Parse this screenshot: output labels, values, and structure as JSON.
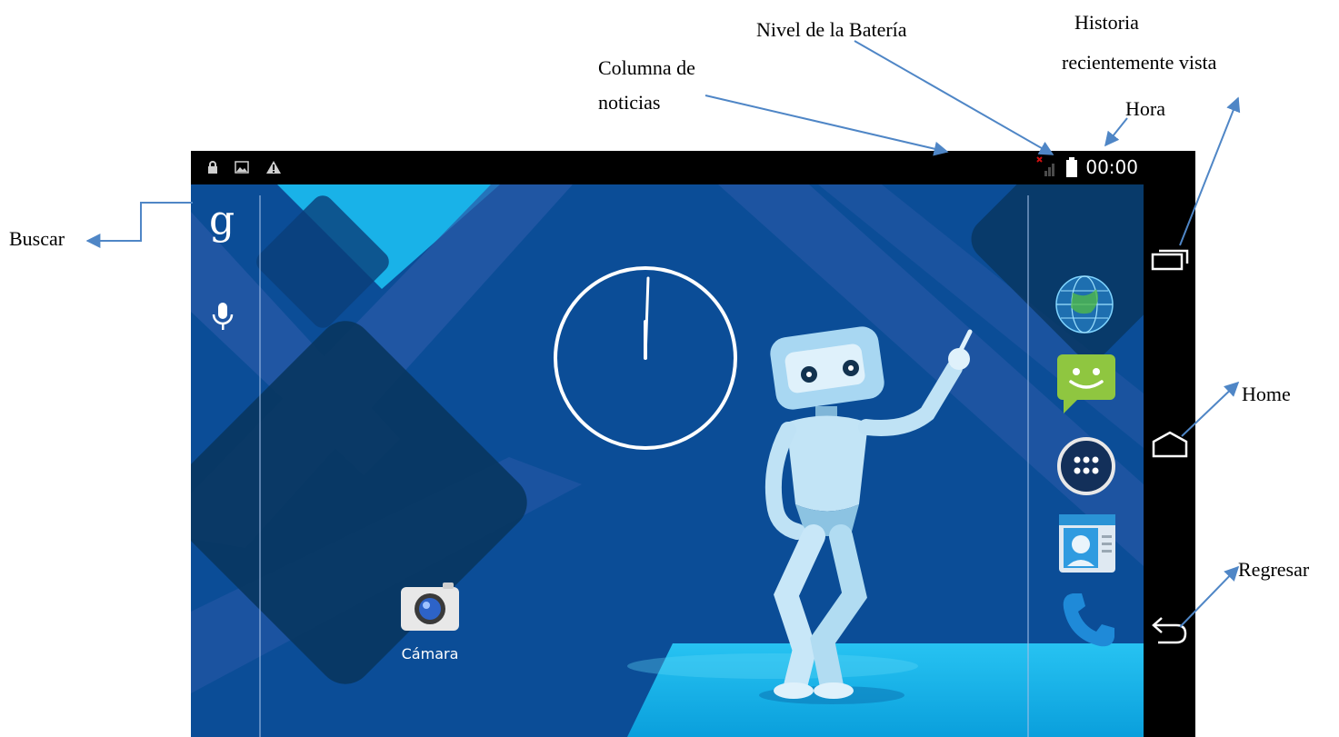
{
  "annotations": {
    "buscar": "Buscar",
    "columna_line1": "Columna  de",
    "columna_line2": "noticias",
    "nivel_bateria": "Nivel de la Batería",
    "historia_line1": "Historia",
    "historia_line2": "recientemente vista",
    "hora": "Hora",
    "home": "Home",
    "regresar": "Regresar"
  },
  "status_bar": {
    "time": "00:00",
    "left_icons": [
      "lock-icon",
      "image-icon",
      "warning-icon"
    ],
    "right_icons": [
      "signal-icon",
      "battery-icon"
    ]
  },
  "search_bar": {
    "google_letter": "g",
    "icons": [
      "google-search-icon",
      "microphone-icon"
    ]
  },
  "home_screen": {
    "camera_app_label": "Cámara"
  },
  "dock": {
    "apps": [
      "browser-globe-icon",
      "messaging-icon",
      "all-apps-icon",
      "contacts-icon",
      "phone-icon"
    ]
  },
  "nav_bar": {
    "buttons": [
      "recent-apps-icon",
      "home-icon",
      "back-icon"
    ]
  },
  "colors": {
    "wallpaper_dark": "#0b4d97",
    "wallpaper_light": "#19b2e8",
    "annotation_arrow": "#4f86c6"
  }
}
